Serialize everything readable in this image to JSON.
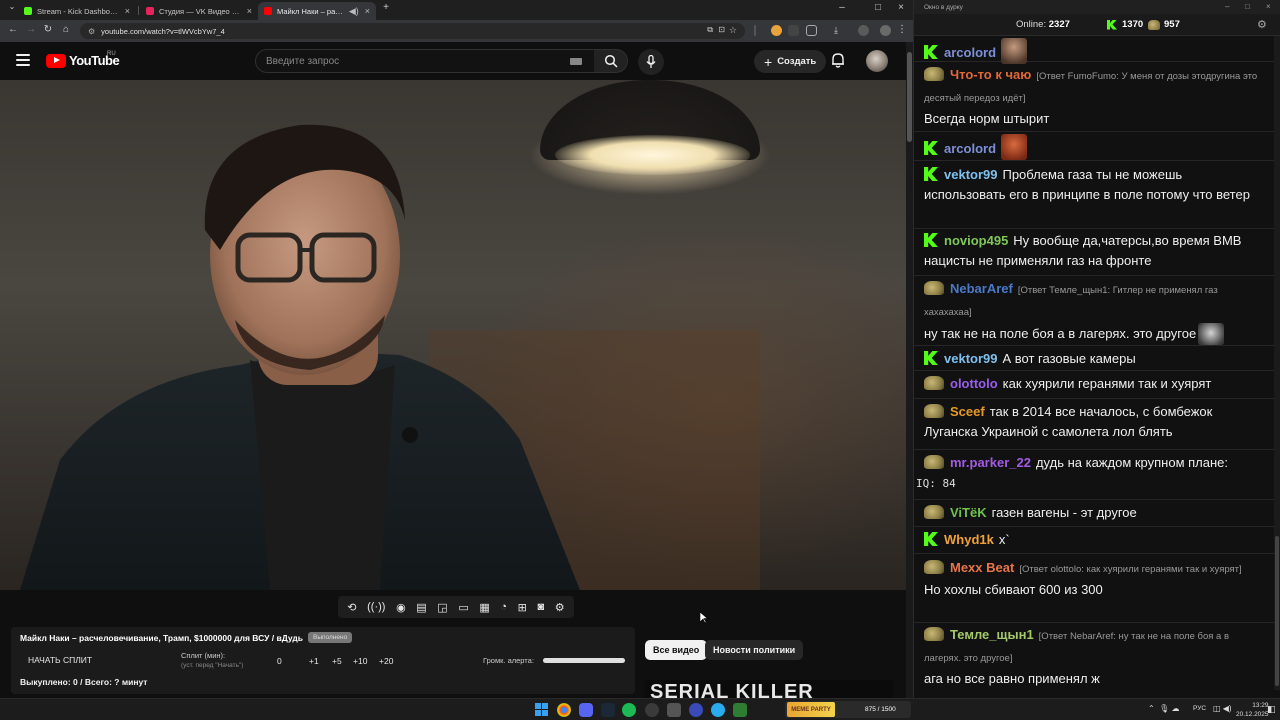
{
  "browser": {
    "tabs": [
      {
        "label": "Stream - Kick Dashboard",
        "favicon_color": "#53fc18",
        "active": false
      },
      {
        "label": "Студия — VK Видео Live",
        "favicon_color": "#e5245b",
        "active": false
      },
      {
        "label": "Майкл Наки – расчелове…",
        "favicon_color": "#ff0000",
        "active": true
      }
    ],
    "new_tab": "+",
    "url": "youtube.com/watch?v=tlWVcbYw7_4"
  },
  "youtube": {
    "logo_text": "YouTube",
    "region": "RU",
    "search_placeholder": "Введите запрос",
    "create_label": "Создать",
    "chips": [
      "Все видео",
      "Новости политики"
    ],
    "thumbnail_text": "SERIAL KILLER"
  },
  "stream_panel": {
    "title": "Майкл Наки – расчеловечивание, Трамп, $1000000 для ВСУ / вДудь",
    "badge": "Выполнено",
    "start_split": "НАЧАТЬ СПЛИТ",
    "split_label": "Сплит (мин):",
    "split_hint": "(уст. перед \"Начать\")",
    "split_value": "0",
    "increments": [
      "+1",
      "+5",
      "+10",
      "+20"
    ],
    "volume_label": "Громк. алерта:",
    "volume_level": 1.0,
    "bought": "Выкуплено: 0 / Всего: ? минут"
  },
  "chat": {
    "window_title": "Окно в дурку",
    "online_label": "Online:",
    "online_value": "2327",
    "kick_count": "1370",
    "other_count": "957",
    "messages": [
      {
        "platform": "kick",
        "nick": "arcolord",
        "nick_color": "#7e8fd9",
        "reply": "",
        "text": "",
        "emote": true
      },
      {
        "platform": "pepe",
        "nick": "Что-то к чаю",
        "nick_color": "#e0683a",
        "reply": "[Ответ FumoFumo: У меня от дозы этодругина это десятый передоз идёт]",
        "text": "Всегда норм штырит",
        "emote": false
      },
      {
        "platform": "kick",
        "nick": "arcolord",
        "nick_color": "#7e8fd9",
        "reply": "",
        "text": "",
        "emote": true
      },
      {
        "platform": "kick",
        "nick": "vektor99",
        "nick_color": "#80c0f0",
        "reply": "",
        "text": "Проблема газа ты не можешь использовать его в принципе в поле потому что ветер",
        "emote": false
      },
      {
        "platform": "kick",
        "nick": "noviop495",
        "nick_color": "#7fc75a",
        "reply": "",
        "text": "Ну вообще да,чатерсы,во время ВМВ нацисты не применяли газ на фронте",
        "emote": false
      },
      {
        "platform": "pepe",
        "nick": "NebarAref",
        "nick_color": "#4a79c7",
        "reply": "[Ответ Темле_щын1: Гитлер не применял газ хахахахаа]",
        "text": "ну так не на поле боя а в лагерях. это другое",
        "emote": true
      },
      {
        "platform": "kick",
        "nick": "vektor99",
        "nick_color": "#80c0f0",
        "reply": "",
        "text": "А вот газовые камеры",
        "emote": false
      },
      {
        "platform": "pepe",
        "nick": "olottolo",
        "nick_color": "#9a5cf0",
        "reply": "",
        "text": "как хуярили геранями так и хуярят",
        "emote": false
      },
      {
        "platform": "pepe",
        "nick": "Sceef",
        "nick_color": "#e89a26",
        "reply": "",
        "text": "так в 2014 все началось, с бомбежок Луганска Украиной с самолета лол блять",
        "emote": false
      },
      {
        "platform": "pepe",
        "nick": "mr.parker_22",
        "nick_color": "#a35be5",
        "reply": "",
        "text": "дудь на каждом крупном плане:",
        "emote": true
      },
      {
        "platform": "pepe",
        "nick": "ViTёK",
        "nick_color": "#6fc24c",
        "reply": "",
        "text": "газен вагены - эт другое",
        "emote": false
      },
      {
        "platform": "kick",
        "nick": "Whyd1k",
        "nick_color": "#f0a23a",
        "reply": "",
        "text": "х`",
        "emote": false
      },
      {
        "platform": "pepe",
        "nick": "Mexx Beat",
        "nick_color": "#e7744a",
        "reply": "[Ответ olottolo: как хуярили геранями так и хуярят]",
        "text": "Но хохлы сбивают 600 из 300",
        "emote": false
      },
      {
        "platform": "pepe",
        "nick": "Темле_щын1",
        "nick_color": "#a3c96b",
        "reply": "[Ответ NebarAref: ну так не на поле боя а в лагерях. это другое]",
        "text": "ага но все равно применял ж",
        "emote": false
      }
    ],
    "emote_caption": "IQ: 84"
  },
  "taskbar": {
    "widget_text": "MEME PARTY",
    "widget_stat": "875 / 1500",
    "lang": "РУС",
    "time": "13:29",
    "date": "20.12.2025"
  }
}
